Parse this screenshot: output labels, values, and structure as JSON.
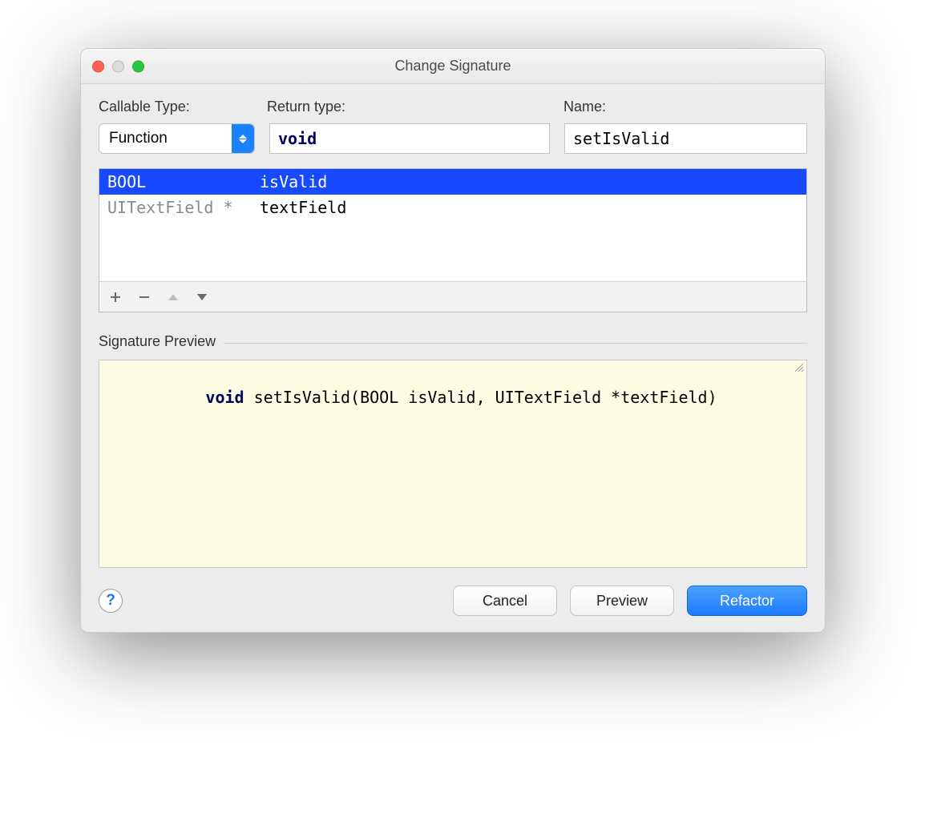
{
  "window": {
    "title": "Change Signature"
  },
  "labels": {
    "callable_type": "Callable Type:",
    "return_type": "Return type:",
    "name": "Name:",
    "preview": "Signature Preview"
  },
  "fields": {
    "callable_type_value": "Function",
    "return_type_value": "void",
    "name_value": "setIsValid"
  },
  "parameters": [
    {
      "type": "BOOL",
      "name": "isValid",
      "selected": true
    },
    {
      "type": "UITextField *",
      "name": "textField",
      "selected": false
    }
  ],
  "toolbar_icons": {
    "add": "plus-icon",
    "remove": "minus-icon",
    "move_up": "chevron-up-icon",
    "move_down": "chevron-down-icon"
  },
  "preview_code": {
    "keyword": "void",
    "rest": " setIsValid(BOOL isValid, UITextField *textField)"
  },
  "buttons": {
    "help": "?",
    "cancel": "Cancel",
    "preview": "Preview",
    "refactor": "Refactor"
  }
}
